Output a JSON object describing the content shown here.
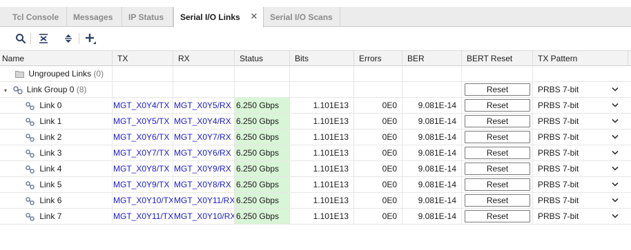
{
  "tabs": [
    {
      "label": "Tcl Console",
      "active": false
    },
    {
      "label": "Messages",
      "active": false
    },
    {
      "label": "IP Status",
      "active": false
    },
    {
      "label": "Serial I/O Links",
      "active": true,
      "closable": true
    },
    {
      "label": "Serial I/O Scans",
      "active": false
    }
  ],
  "toolbar": {
    "icons": [
      "search-icon",
      "collapse-all-icon",
      "expand-all-icon",
      "add-link-icon"
    ]
  },
  "columns": {
    "name": "Name",
    "tx": "TX",
    "rx": "RX",
    "status": "Status",
    "bits": "Bits",
    "errors": "Errors",
    "ber": "BER",
    "bert_reset": "BERT Reset",
    "tx_pattern": "TX Pattern"
  },
  "ungrouped": {
    "label": "Ungrouped Links",
    "count": "(0)"
  },
  "group": {
    "label": "Link Group 0",
    "count": "(8)",
    "reset_label": "Reset",
    "tx_pattern": "PRBS 7-bit"
  },
  "links": [
    {
      "name": "Link 0",
      "tx": "MGT_X0Y4/TX",
      "rx": "MGT_X0Y5/RX",
      "status": "6.250 Gbps",
      "bits": "1.101E13",
      "errors": "0E0",
      "ber": "9.081E-14",
      "reset": "Reset",
      "tx_pattern": "PRBS 7-bit"
    },
    {
      "name": "Link 1",
      "tx": "MGT_X0Y5/TX",
      "rx": "MGT_X0Y4/RX",
      "status": "6.250 Gbps",
      "bits": "1.101E13",
      "errors": "0E0",
      "ber": "9.081E-14",
      "reset": "Reset",
      "tx_pattern": "PRBS 7-bit"
    },
    {
      "name": "Link 2",
      "tx": "MGT_X0Y6/TX",
      "rx": "MGT_X0Y7/RX",
      "status": "6.250 Gbps",
      "bits": "1.101E13",
      "errors": "0E0",
      "ber": "9.081E-14",
      "reset": "Reset",
      "tx_pattern": "PRBS 7-bit"
    },
    {
      "name": "Link 3",
      "tx": "MGT_X0Y7/TX",
      "rx": "MGT_X0Y6/RX",
      "status": "6.250 Gbps",
      "bits": "1.101E13",
      "errors": "0E0",
      "ber": "9.081E-14",
      "reset": "Reset",
      "tx_pattern": "PRBS 7-bit"
    },
    {
      "name": "Link 4",
      "tx": "MGT_X0Y8/TX",
      "rx": "MGT_X0Y9/RX",
      "status": "6.250 Gbps",
      "bits": "1.101E13",
      "errors": "0E0",
      "ber": "9.081E-14",
      "reset": "Reset",
      "tx_pattern": "PRBS 7-bit"
    },
    {
      "name": "Link 5",
      "tx": "MGT_X0Y9/TX",
      "rx": "MGT_X0Y8/RX",
      "status": "6.250 Gbps",
      "bits": "1.101E13",
      "errors": "0E0",
      "ber": "9.081E-14",
      "reset": "Reset",
      "tx_pattern": "PRBS 7-bit"
    },
    {
      "name": "Link 6",
      "tx": "MGT_X0Y10/TX",
      "rx": "MGT_X0Y11/RX",
      "status": "6.250 Gbps",
      "bits": "1.101E13",
      "errors": "0E0",
      "ber": "9.081E-14",
      "reset": "Reset",
      "tx_pattern": "PRBS 7-bit"
    },
    {
      "name": "Link 7",
      "tx": "MGT_X0Y11/TX",
      "rx": "MGT_X0Y10/RX",
      "status": "6.250 Gbps",
      "bits": "1.101E13",
      "errors": "0E0",
      "ber": "9.081E-14",
      "reset": "Reset",
      "tx_pattern": "PRBS 7-bit"
    }
  ],
  "colors": {
    "link_text": "#1a1acd",
    "status_ok_bg": "#d9f5d7"
  }
}
